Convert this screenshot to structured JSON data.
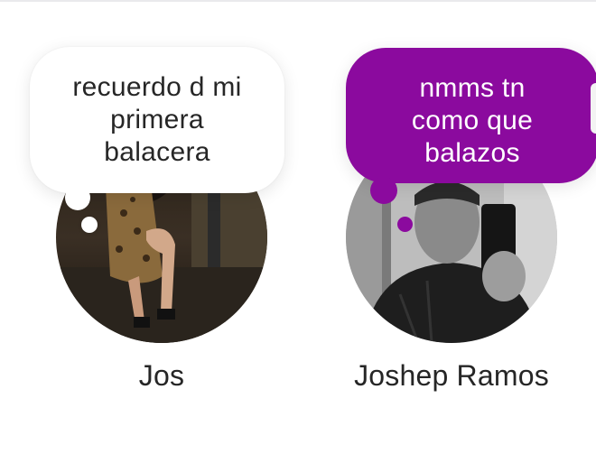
{
  "notes": [
    {
      "id": "note-1",
      "text_lines": [
        "recuerdo d mi",
        "primera",
        "balacera"
      ],
      "name": "Jos",
      "bubble_color": "#ffffff",
      "text_color": "#262626"
    },
    {
      "id": "note-2",
      "text_lines": [
        "nmms tn",
        "como que",
        "balazos"
      ],
      "name": "Joshep Ramos",
      "bubble_color": "#8b0a9e",
      "text_color": "#ffffff"
    }
  ],
  "colors": {
    "background": "#ffffff",
    "name_text": "#262626",
    "accent_purple": "#8b0a9e"
  }
}
